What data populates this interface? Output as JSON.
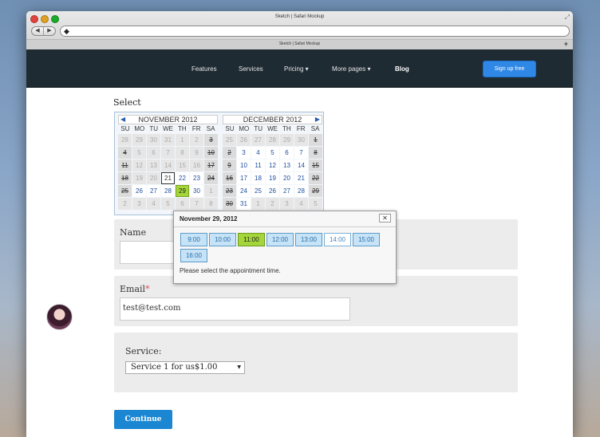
{
  "window": {
    "title": "Sketch | Safari Mockup",
    "tab_label": "Sketch | Safari Mockup",
    "tab_add": "+"
  },
  "nav": {
    "items": [
      "Features",
      "Services",
      "Pricing ▾",
      "More pages ▾",
      "Blog"
    ],
    "signup": "Sign up free"
  },
  "form": {
    "select_label": "Select",
    "name_label": "Name",
    "email_label": "Email",
    "email_required": "*",
    "email_value": "test@test.com",
    "service_label": "Service:",
    "service_value": "Service 1 for us$1.00",
    "continue": "Continue"
  },
  "calendar": {
    "dow": [
      "SU",
      "MO",
      "TU",
      "WE",
      "TH",
      "FR",
      "SA"
    ],
    "months": [
      {
        "title": "NOVEMBER 2012",
        "days": [
          [
            "28",
            "off"
          ],
          [
            "29",
            "off"
          ],
          [
            "30",
            "off"
          ],
          [
            "31",
            "off"
          ],
          [
            "1",
            "off"
          ],
          [
            "2",
            "off"
          ],
          [
            "3",
            "strike"
          ],
          [
            "4",
            "strike"
          ],
          [
            "5",
            "off"
          ],
          [
            "6",
            "off"
          ],
          [
            "7",
            "off"
          ],
          [
            "8",
            "off"
          ],
          [
            "9",
            "off"
          ],
          [
            "10",
            "strike"
          ],
          [
            "11",
            "strike"
          ],
          [
            "12",
            "off"
          ],
          [
            "13",
            "off"
          ],
          [
            "14",
            "off"
          ],
          [
            "15",
            "off"
          ],
          [
            "16",
            "off"
          ],
          [
            "17",
            "strike"
          ],
          [
            "18",
            "strike"
          ],
          [
            "19",
            "off"
          ],
          [
            "20",
            "off"
          ],
          [
            "21",
            "today"
          ],
          [
            "22",
            "avail"
          ],
          [
            "23",
            "avail"
          ],
          [
            "24",
            "strike"
          ],
          [
            "25",
            "strike"
          ],
          [
            "26",
            "avail"
          ],
          [
            "27",
            "avail"
          ],
          [
            "28",
            "avail"
          ],
          [
            "29",
            "sel"
          ],
          [
            "30",
            "avail"
          ],
          [
            "1",
            "off"
          ],
          [
            "2",
            "off"
          ],
          [
            "3",
            "off"
          ],
          [
            "4",
            "off"
          ],
          [
            "5",
            "off"
          ],
          [
            "6",
            "off"
          ],
          [
            "7",
            "off"
          ],
          [
            "8",
            "off"
          ]
        ]
      },
      {
        "title": "DECEMBER 2012",
        "days": [
          [
            "25",
            "off"
          ],
          [
            "26",
            "off"
          ],
          [
            "27",
            "off"
          ],
          [
            "28",
            "off"
          ],
          [
            "29",
            "off"
          ],
          [
            "30",
            "off"
          ],
          [
            "1",
            "strike"
          ],
          [
            "2",
            "strike"
          ],
          [
            "3",
            "avail"
          ],
          [
            "4",
            "avail"
          ],
          [
            "5",
            "avail"
          ],
          [
            "6",
            "avail"
          ],
          [
            "7",
            "avail"
          ],
          [
            "8",
            "strike"
          ],
          [
            "9",
            "strike"
          ],
          [
            "10",
            "avail"
          ],
          [
            "11",
            "avail"
          ],
          [
            "12",
            "avail"
          ],
          [
            "13",
            "avail"
          ],
          [
            "14",
            "avail"
          ],
          [
            "15",
            "strike"
          ],
          [
            "16",
            "strike"
          ],
          [
            "17",
            "avail"
          ],
          [
            "18",
            "avail"
          ],
          [
            "19",
            "avail"
          ],
          [
            "20",
            "avail"
          ],
          [
            "21",
            "avail"
          ],
          [
            "22",
            "strike"
          ],
          [
            "23",
            "strike"
          ],
          [
            "24",
            "avail"
          ],
          [
            "25",
            "avail"
          ],
          [
            "26",
            "avail"
          ],
          [
            "27",
            "avail"
          ],
          [
            "28",
            "avail"
          ],
          [
            "29",
            "strike"
          ],
          [
            "30",
            "strike"
          ],
          [
            "31",
            "avail"
          ],
          [
            "1",
            "off"
          ],
          [
            "2",
            "off"
          ],
          [
            "3",
            "off"
          ],
          [
            "4",
            "off"
          ],
          [
            "5",
            "off"
          ]
        ]
      }
    ]
  },
  "popup": {
    "title": "November 29, 2012",
    "close": "✕",
    "times": [
      [
        "9:00",
        "avail"
      ],
      [
        "10:00",
        "avail"
      ],
      [
        "11:00",
        "selected"
      ],
      [
        "12:00",
        "avail"
      ],
      [
        "13:00",
        "avail"
      ],
      [
        "14:00",
        "taken"
      ],
      [
        "15:00",
        "avail"
      ],
      [
        "16:00",
        "avail"
      ]
    ],
    "hint": "Please select the appointment time."
  }
}
